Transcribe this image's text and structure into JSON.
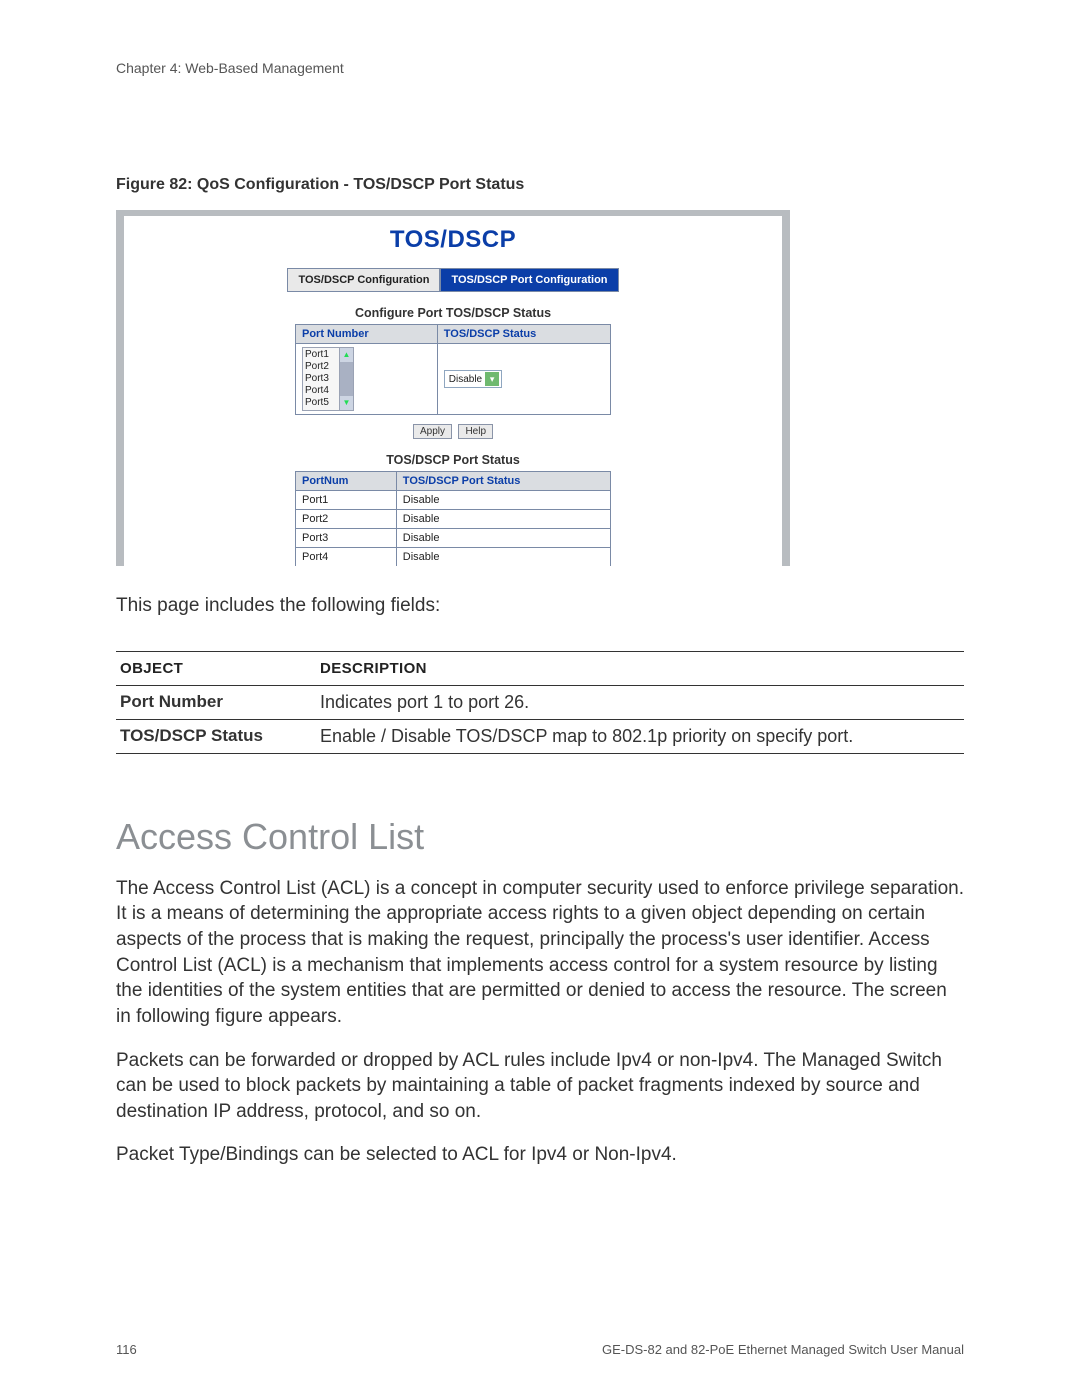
{
  "header": {
    "chapter": "Chapter 4: Web-Based Management"
  },
  "figure_caption": "Figure 82: QoS Configuration - TOS/DSCP Port Status",
  "screenshot": {
    "title": "TOS/DSCP",
    "tabs": {
      "config": "TOS/DSCP Configuration",
      "port_config": "TOS/DSCP Port Configuration"
    },
    "cfg_title": "Configure Port TOS/DSCP Status",
    "cfg_headers": {
      "port": "Port Number",
      "status": "TOS/DSCP Status"
    },
    "port_listbox": [
      "Port1",
      "Port2",
      "Port3",
      "Port4",
      "Port5"
    ],
    "status_dropdown": "Disable",
    "buttons": {
      "apply": "Apply",
      "help": "Help"
    },
    "status_title": "TOS/DSCP Port Status",
    "status_headers": {
      "portnum": "PortNum",
      "status": "TOS/DSCP Port Status"
    },
    "status_rows": [
      {
        "port": "Port1",
        "status": "Disable"
      },
      {
        "port": "Port2",
        "status": "Disable"
      },
      {
        "port": "Port3",
        "status": "Disable"
      },
      {
        "port": "Port4",
        "status": "Disable"
      }
    ]
  },
  "intro_text": "This page includes the following fields:",
  "fields_table": {
    "headers": {
      "object": "OBJECT",
      "desc": "DESCRIPTION"
    },
    "rows": [
      {
        "object": "Port Number",
        "desc": "Indicates port 1 to port 26."
      },
      {
        "object": "TOS/DSCP Status",
        "desc": "Enable / Disable TOS/DSCP map to 802.1p priority on specify port."
      }
    ]
  },
  "section_heading": "Access Control List",
  "paragraphs": {
    "p1": "The Access Control List (ACL) is a concept in computer security used to enforce privilege separation. It is a means of determining the appropriate access rights to a given object depending on certain aspects of the process that is making the request, principally the process's user identifier. Access Control List (ACL) is a mechanism that implements access control for a system resource by listing the identities of the system entities that are permitted or denied to access the resource. The screen in following figure appears.",
    "p2": "Packets can be forwarded or dropped by ACL rules include Ipv4 or non-Ipv4. The Managed Switch can be used to block packets by maintaining a table of packet fragments indexed by source and destination IP address, protocol, and so on.",
    "p3": "Packet Type/Bindings can be selected to ACL for Ipv4 or Non-Ipv4."
  },
  "footer": {
    "page": "116",
    "manual": "GE-DS-82 and 82-PoE Ethernet Managed Switch User Manual"
  }
}
